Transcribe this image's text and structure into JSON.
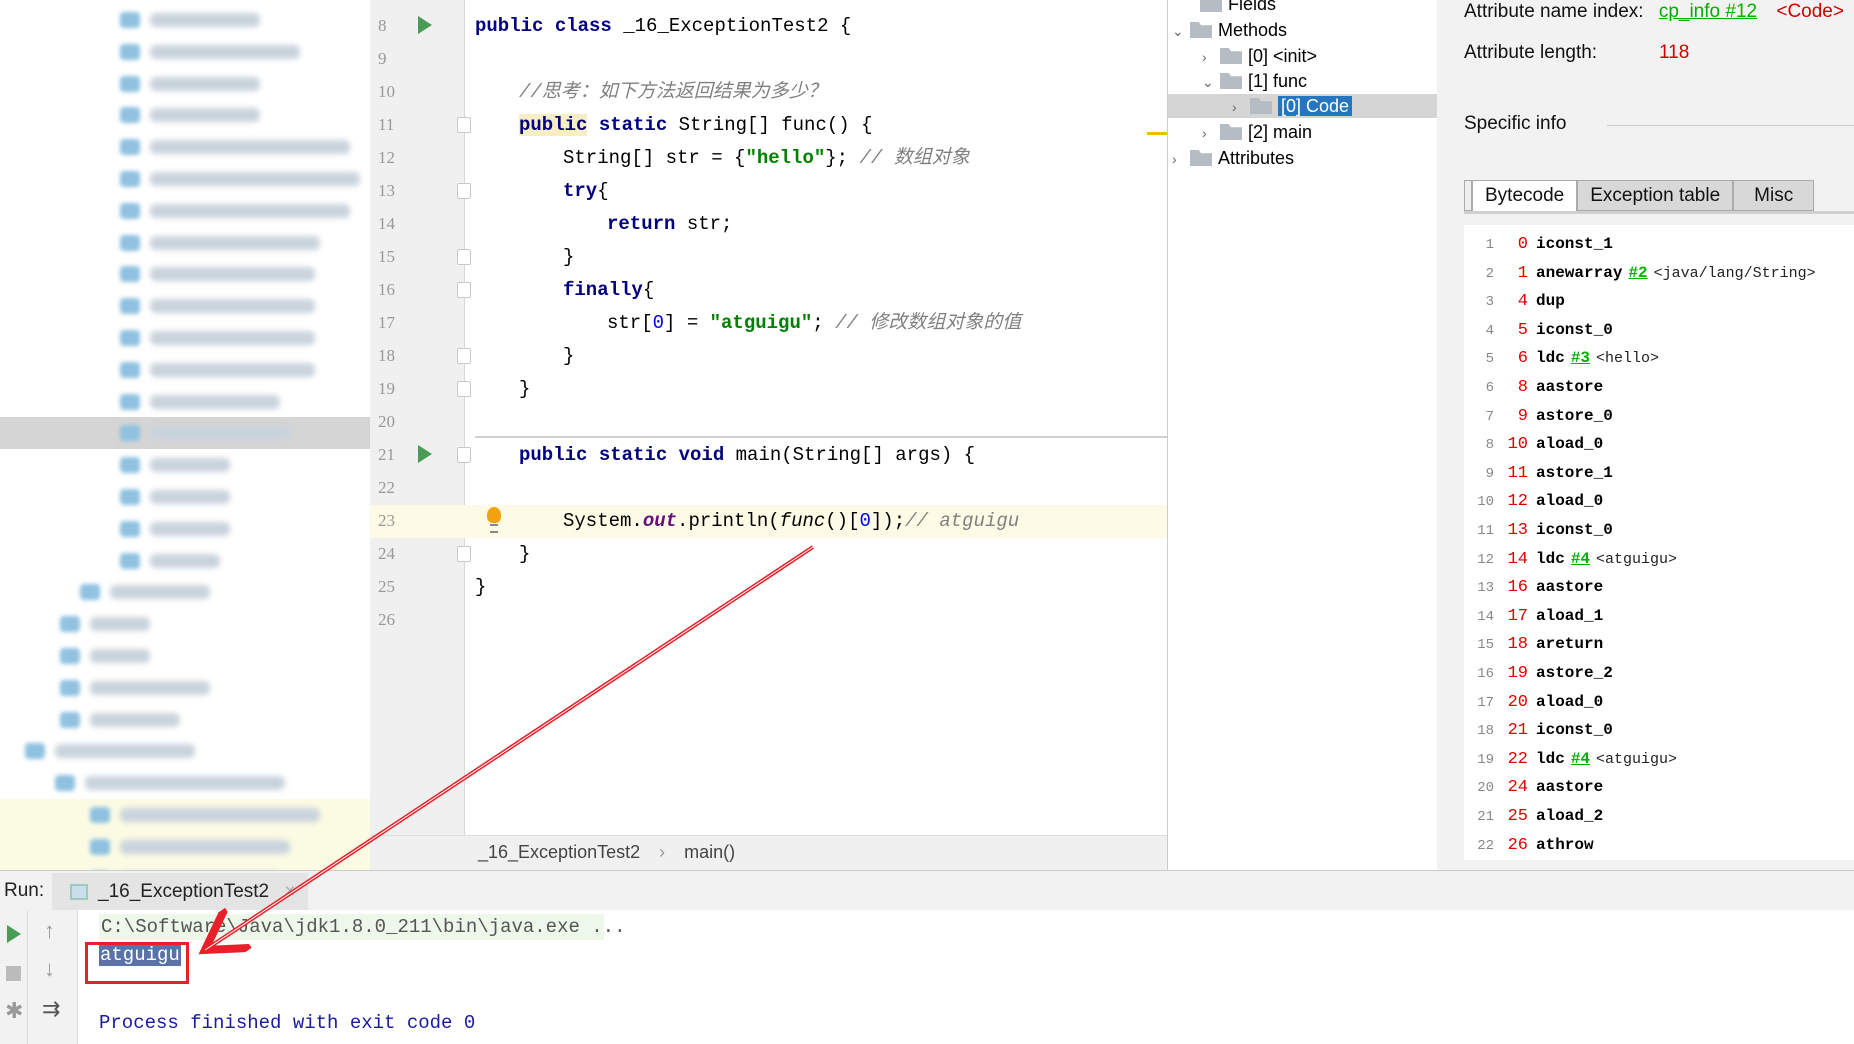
{
  "editor": {
    "lines": [
      {
        "n": "8",
        "tokens": [
          [
            "kw",
            "public class "
          ],
          [
            "",
            "_16_ExceptionTest2 {"
          ]
        ],
        "indent": 0,
        "run": true
      },
      {
        "n": "9",
        "tokens": [],
        "indent": 0
      },
      {
        "n": "10",
        "tokens": [
          [
            "cm",
            "//思考：如下方法返回结果为多少？"
          ]
        ],
        "indent": 1
      },
      {
        "n": "11",
        "tokens": [
          [
            "kw hl",
            "public"
          ],
          [
            "kw",
            " static "
          ],
          [
            "",
            "String[] func() {"
          ]
        ],
        "indent": 1,
        "fold": true
      },
      {
        "n": "12",
        "tokens": [
          [
            "",
            "String[] str = {"
          ],
          [
            "str",
            "\"hello\""
          ],
          [
            "",
            "}; "
          ],
          [
            "cm",
            "// 数组对象"
          ]
        ],
        "indent": 2
      },
      {
        "n": "13",
        "tokens": [
          [
            "kw",
            "try"
          ],
          [
            "",
            "{"
          ]
        ],
        "indent": 2,
        "fold": true
      },
      {
        "n": "14",
        "tokens": [
          [
            "kw",
            "return "
          ],
          [
            "",
            "str;"
          ]
        ],
        "indent": 3
      },
      {
        "n": "15",
        "tokens": [
          [
            "",
            "}"
          ]
        ],
        "indent": 2,
        "fold": true
      },
      {
        "n": "16",
        "tokens": [
          [
            "kw",
            "finally"
          ],
          [
            "",
            "{"
          ]
        ],
        "indent": 2,
        "fold": true
      },
      {
        "n": "17",
        "tokens": [
          [
            "",
            "str["
          ],
          [
            "num",
            "0"
          ],
          [
            "",
            "] = "
          ],
          [
            "str",
            "\"atguigu\""
          ],
          [
            "",
            "; "
          ],
          [
            "cm",
            "// 修改数组对象的值"
          ]
        ],
        "indent": 3
      },
      {
        "n": "18",
        "tokens": [
          [
            "",
            "}"
          ]
        ],
        "indent": 2,
        "fold": true
      },
      {
        "n": "19",
        "tokens": [
          [
            "",
            "}"
          ]
        ],
        "indent": 1,
        "fold": true
      },
      {
        "n": "20",
        "tokens": [],
        "indent": 0
      },
      {
        "n": "21",
        "tokens": [
          [
            "kw",
            "public static void "
          ],
          [
            "",
            "main(String[] args) {"
          ]
        ],
        "indent": 1,
        "run": true,
        "fold": true
      },
      {
        "n": "22",
        "tokens": [],
        "indent": 0
      },
      {
        "n": "23",
        "tokens": [
          [
            "",
            "System."
          ],
          [
            "sf",
            "out"
          ],
          [
            "",
            ".println("
          ],
          [
            "fn",
            "func"
          ],
          [
            "",
            "()["
          ],
          [
            "num",
            "0"
          ],
          [
            "",
            "]);"
          ],
          [
            "cm",
            "// atguigu"
          ]
        ],
        "indent": 2
      },
      {
        "n": "24",
        "tokens": [
          [
            "",
            "}"
          ]
        ],
        "indent": 1,
        "fold": true
      },
      {
        "n": "25",
        "tokens": [
          [
            "",
            "}"
          ]
        ],
        "indent": 0
      },
      {
        "n": "26",
        "tokens": [],
        "indent": 0
      }
    ],
    "breadcrumb": [
      "_16_ExceptionTest2",
      "›",
      "main()"
    ]
  },
  "tree": {
    "fields": "Fields",
    "methods": "Methods",
    "init": "[0] <init>",
    "func": "[1] func",
    "code": "[0] Code",
    "main": "[2] main",
    "attributes": "Attributes"
  },
  "detail": {
    "name_index_label": "Attribute name index:",
    "name_index_link": "cp_info #12",
    "name_index_value": "<Code>",
    "length_label": "Attribute length:",
    "length_value": "118",
    "specific_info": "Specific info",
    "tabs": [
      "Bytecode",
      "Exception table",
      "Misc"
    ],
    "bytecode": [
      [
        "1",
        "0",
        "iconst_1",
        "",
        ""
      ],
      [
        "2",
        "1",
        "anewarray",
        "#2",
        "<java/lang/String>"
      ],
      [
        "3",
        "4",
        "dup",
        "",
        ""
      ],
      [
        "4",
        "5",
        "iconst_0",
        "",
        ""
      ],
      [
        "5",
        "6",
        "ldc",
        "#3",
        "<hello>"
      ],
      [
        "6",
        "8",
        "aastore",
        "",
        ""
      ],
      [
        "7",
        "9",
        "astore_0",
        "",
        ""
      ],
      [
        "8",
        "10",
        "aload_0",
        "",
        ""
      ],
      [
        "9",
        "11",
        "astore_1",
        "",
        ""
      ],
      [
        "10",
        "12",
        "aload_0",
        "",
        ""
      ],
      [
        "11",
        "13",
        "iconst_0",
        "",
        ""
      ],
      [
        "12",
        "14",
        "ldc",
        "#4",
        "<atguigu>"
      ],
      [
        "13",
        "16",
        "aastore",
        "",
        ""
      ],
      [
        "14",
        "17",
        "aload_1",
        "",
        ""
      ],
      [
        "15",
        "18",
        "areturn",
        "",
        ""
      ],
      [
        "16",
        "19",
        "astore_2",
        "",
        ""
      ],
      [
        "17",
        "20",
        "aload_0",
        "",
        ""
      ],
      [
        "18",
        "21",
        "iconst_0",
        "",
        ""
      ],
      [
        "19",
        "22",
        "ldc",
        "#4",
        "<atguigu>"
      ],
      [
        "20",
        "24",
        "aastore",
        "",
        ""
      ],
      [
        "21",
        "25",
        "aload_2",
        "",
        ""
      ],
      [
        "22",
        "26",
        "athrow",
        "",
        ""
      ]
    ]
  },
  "run": {
    "label": "Run:",
    "tab": "_16_ExceptionTest2",
    "close": "×",
    "command": "C:\\Software\\Java\\jdk1.8.0_211\\bin\\java.exe ...",
    "output": "atguigu",
    "exit": "Process finished with exit code 0"
  },
  "colors": {
    "annotation": "#e8202a",
    "selection": "#2675bf",
    "link": "#00b000",
    "offset": "#e00000"
  }
}
